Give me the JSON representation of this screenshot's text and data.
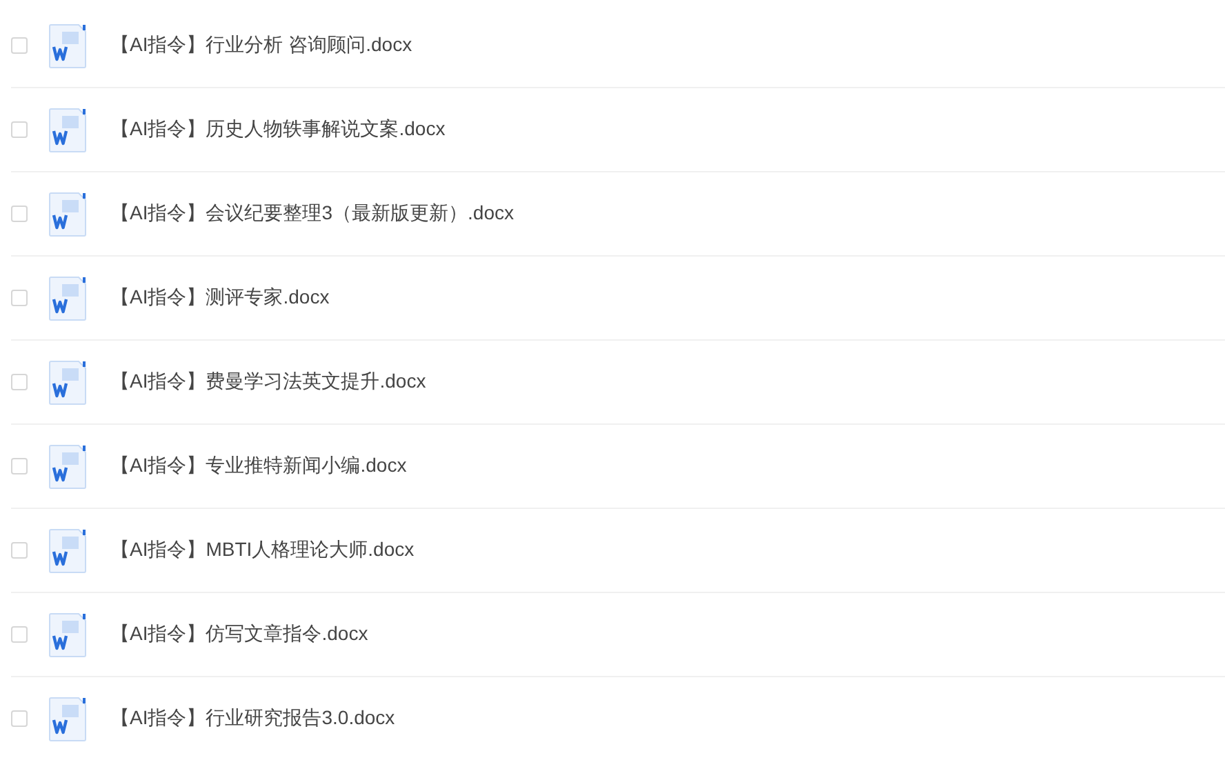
{
  "files": [
    {
      "name": "【AI指令】行业分析 咨询顾问.docx",
      "checked": false
    },
    {
      "name": "【AI指令】历史人物轶事解说文案.docx",
      "checked": false
    },
    {
      "name": "【AI指令】会议纪要整理3（最新版更新）.docx",
      "checked": false
    },
    {
      "name": "【AI指令】测评专家.docx",
      "checked": false
    },
    {
      "name": "【AI指令】费曼学习法英文提升.docx",
      "checked": false
    },
    {
      "name": "【AI指令】专业推特新闻小编.docx",
      "checked": false
    },
    {
      "name": "【AI指令】MBTI人格理论大师.docx",
      "checked": false
    },
    {
      "name": "【AI指令】仿写文章指令.docx",
      "checked": false
    },
    {
      "name": "【AI指令】行业研究报告3.0.docx",
      "checked": false
    }
  ]
}
